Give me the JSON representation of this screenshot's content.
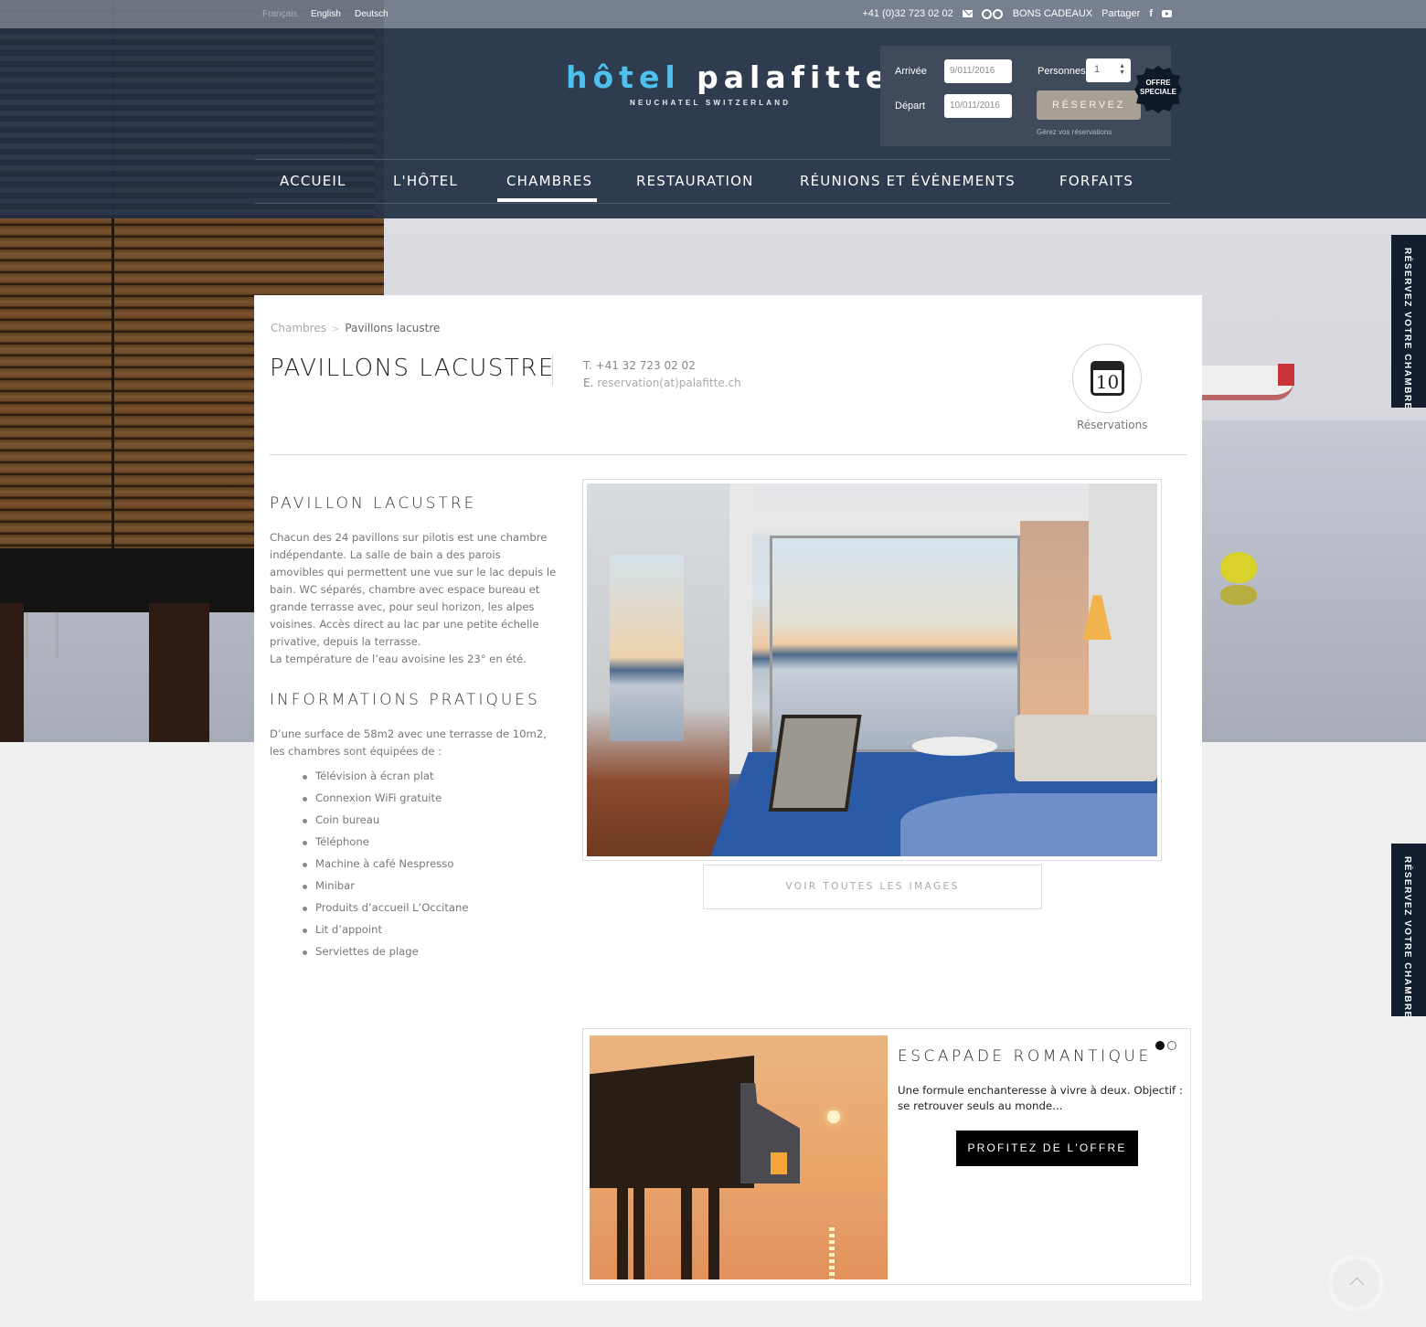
{
  "topbar": {
    "languages": [
      {
        "label": "Français",
        "active": false
      },
      {
        "label": "English",
        "active": true
      },
      {
        "label": "Deutsch",
        "active": true
      }
    ],
    "phone": "+41 (0)32 723 02 02",
    "gift_vouchers": "BONS CADEAUX",
    "share": "Partager",
    "icons": [
      "mail-icon",
      "tripadvisor-icon",
      "facebook-icon",
      "youtube-icon"
    ]
  },
  "header": {
    "logo_part1": "hôtel",
    "logo_part2": "palafitte",
    "logo_sub": "NEUCHATEL SWITZERLAND",
    "brand_color": "#4ec0ee"
  },
  "booking": {
    "arrival_label": "Arrivée",
    "arrival_value": "9/011/2016",
    "departure_label": "Départ",
    "departure_value": "10/011/2016",
    "persons_label": "Personnes",
    "persons_value": "1",
    "submit_label": "RÉSERVEZ",
    "manage_link": "Gérez vos réservations",
    "offer_badge_line1": "OFFRE",
    "offer_badge_line2": "SPECIALE"
  },
  "nav": {
    "items": [
      "ACCUEIL",
      "L'HÔTEL",
      "CHAMBRES",
      "RESTAURATION",
      "RÉUNIONS ET ÉVÈNEMENTS",
      "FORFAITS"
    ],
    "active": "CHAMBRES"
  },
  "side_tab": {
    "label": "RÉSERVEZ VOTRE CHAMBRE"
  },
  "page": {
    "breadcrumb": [
      "Chambres",
      "Pavillons lacustre"
    ],
    "breadcrumb_sep": ">",
    "title": "PAVILLONS LACUSTRE",
    "phone": "T. +41 32 723 02 02",
    "email_prefix": "E.",
    "email": "reservation(at)palafitte.ch",
    "reservations_label": "Réservations",
    "calendar_day": "10"
  },
  "room": {
    "heading": "PAVILLON LACUSTRE",
    "description": "Chacun des 24 pavillons sur pilotis est une chambre indépendante. La salle de bain a des parois amovibles qui permettent une vue sur le lac depuis le bain. WC séparés, chambre avec espace bureau et grande terrasse avec, pour seul horizon, les alpes voisines. Accès direct au lac par une petite échelle privative, depuis la terrasse.",
    "description_2": "La température de l’eau avoisine les 23° en été.",
    "info_heading": "INFORMATIONS PRATIQUES",
    "info_text": "D’une surface de 58m2 avec une terrasse de 10m2, les chambres sont équipées de :",
    "features": [
      "Télévision à écran plat",
      "Connexion WiFi gratuite",
      "Coin bureau",
      "Téléphone",
      "Machine à café Nespresso",
      "Minibar",
      "Produits d’accueil L’Occitane",
      "Lit d’appoint",
      "Serviettes de plage"
    ],
    "view_all_label": "VOIR TOUTES LES IMAGES"
  },
  "offer": {
    "title": "ESCAPADE ROMANTIQUE",
    "description": "Une formule enchanteresse à vivre à deux. Objectif : se retrouver seuls au monde...",
    "cta": "PROFITEZ DE L'OFFRE",
    "slides": 2,
    "active_slide": 1
  }
}
